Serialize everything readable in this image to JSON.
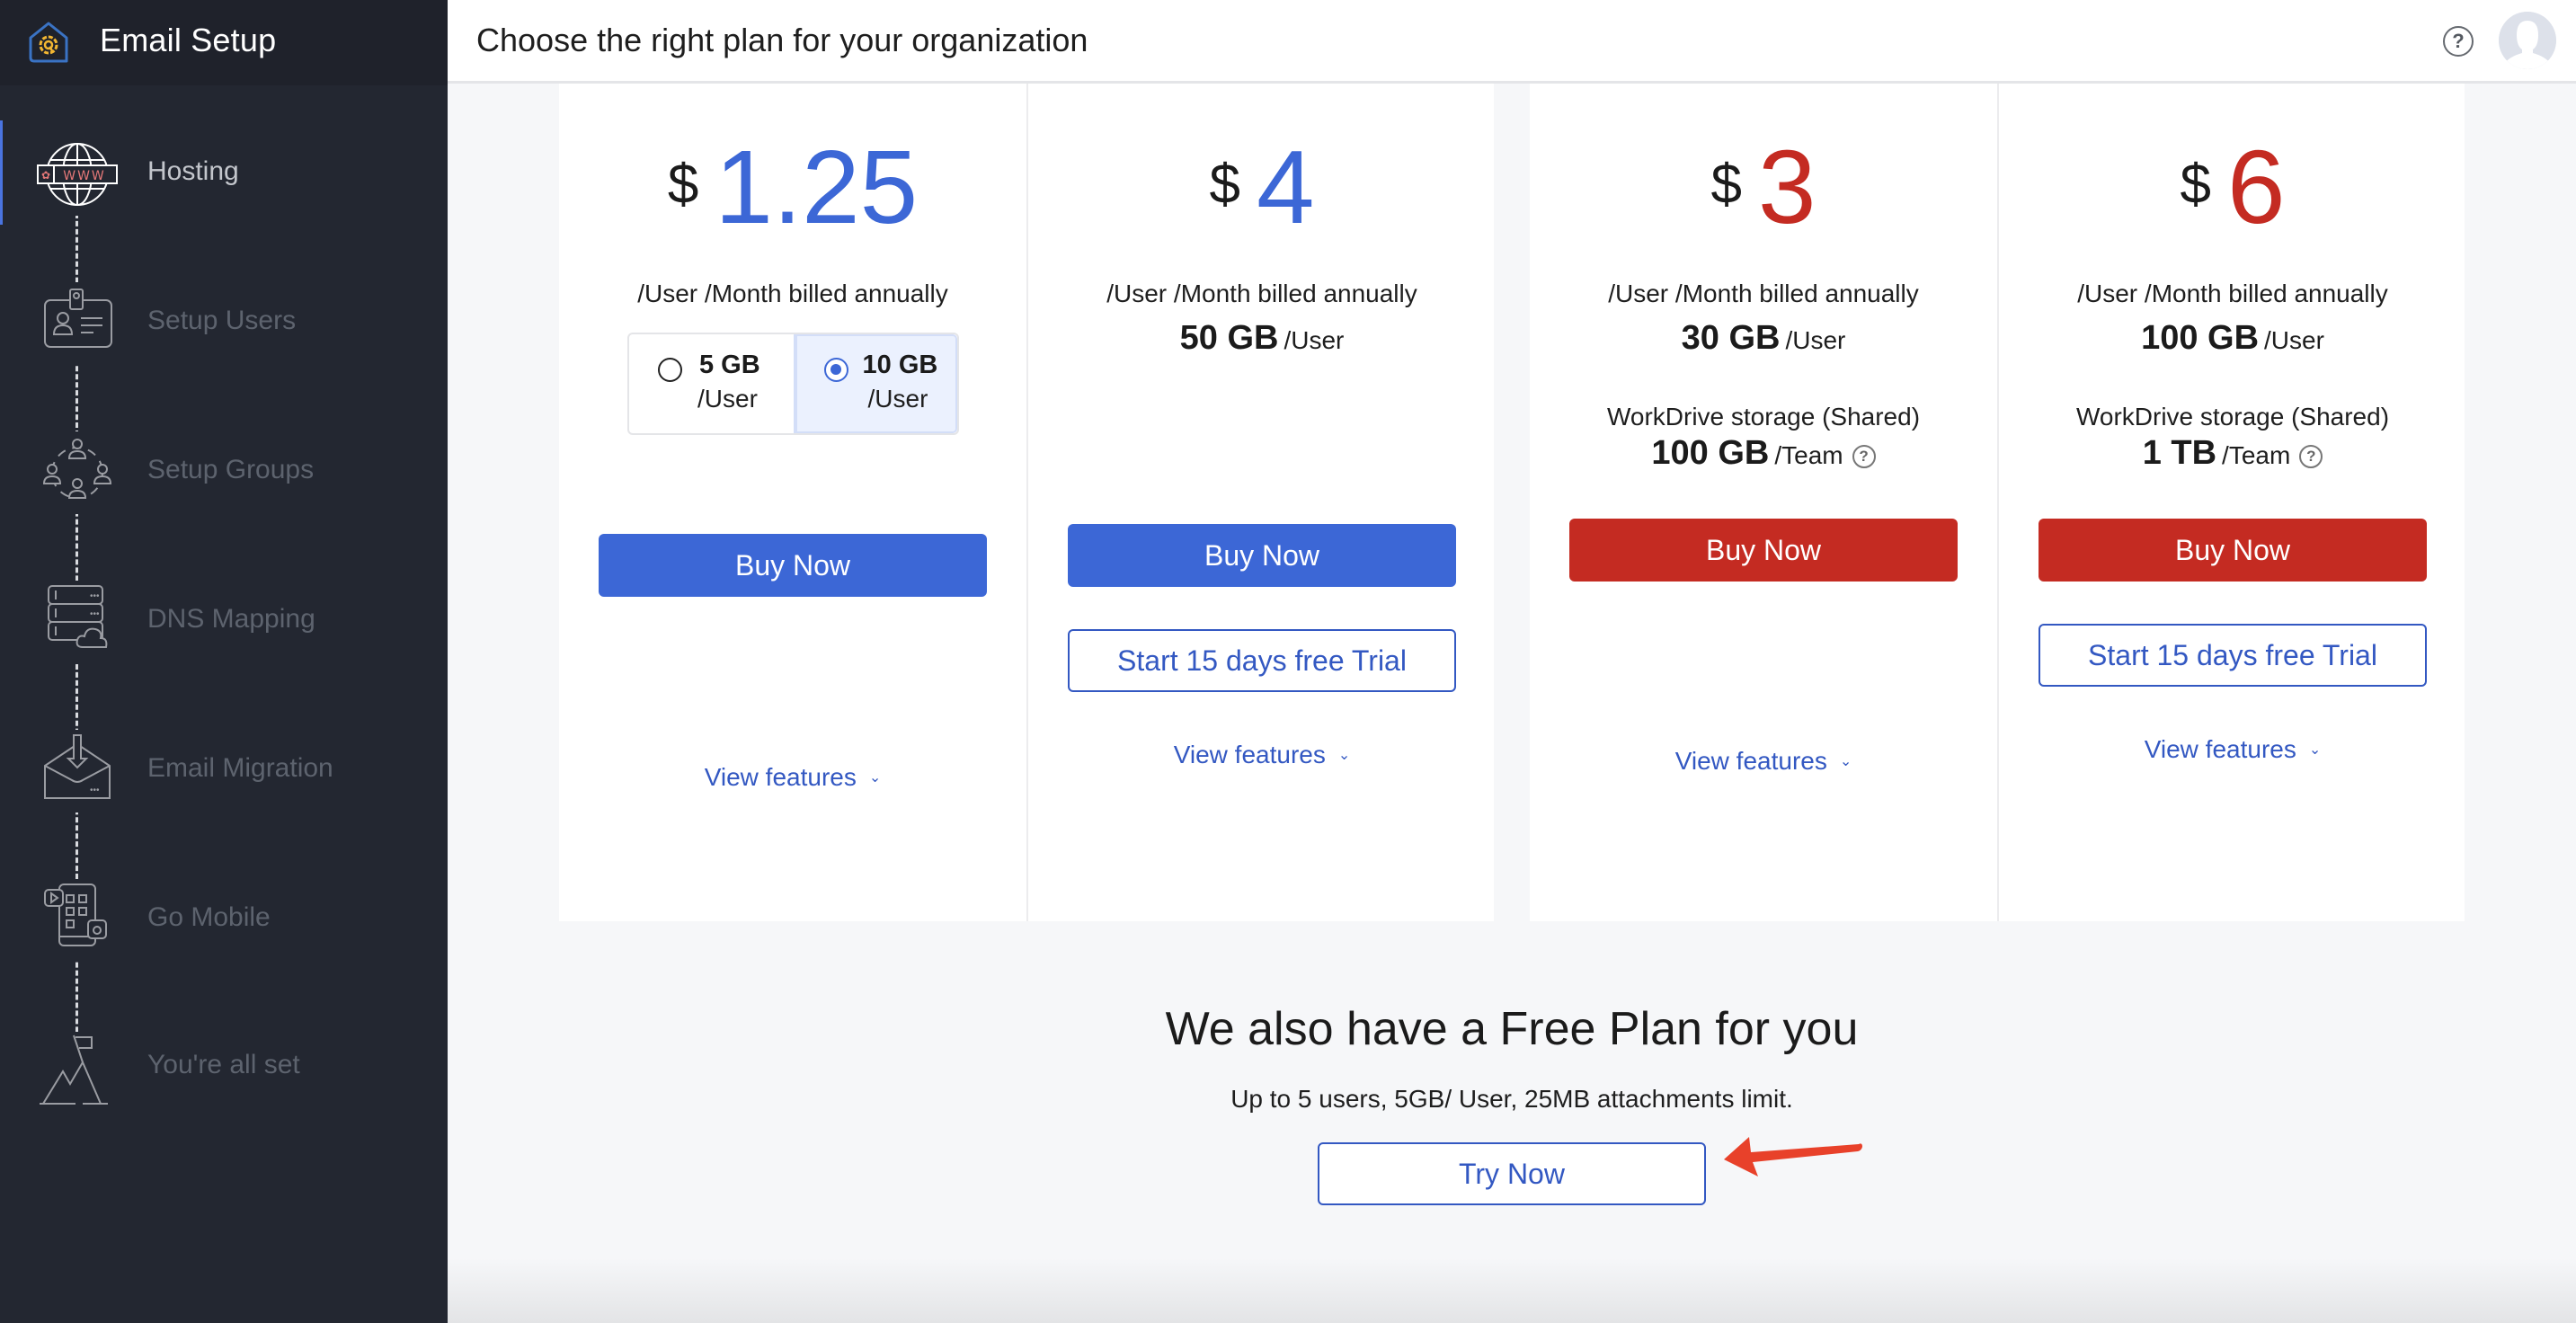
{
  "sidebar": {
    "title": "Email Setup",
    "logo_icon": "house-gear-icon",
    "steps": [
      {
        "label": "Hosting",
        "icon": "globe-www-icon",
        "active": true
      },
      {
        "label": "Setup Users",
        "icon": "id-badge-icon",
        "active": false
      },
      {
        "label": "Setup Groups",
        "icon": "group-circle-icon",
        "active": false
      },
      {
        "label": "DNS Mapping",
        "icon": "server-cloud-icon",
        "active": false
      },
      {
        "label": "Email Migration",
        "icon": "envelope-download-icon",
        "active": false
      },
      {
        "label": "Go Mobile",
        "icon": "mobile-apps-icon",
        "active": false
      },
      {
        "label": "You're all set",
        "icon": "mountain-flag-icon",
        "active": false
      }
    ]
  },
  "header": {
    "title": "Choose the right plan for your organization",
    "help_icon": "?",
    "avatar_icon": "user-avatar-icon"
  },
  "plans": [
    {
      "currency": "$",
      "price": "1.25",
      "price_color": "#3c67d6",
      "billing": "/User /Month billed annually",
      "storage_options": [
        {
          "size": "5 GB",
          "unit": "/User",
          "selected": false
        },
        {
          "size": "10 GB",
          "unit": "/User",
          "selected": true
        }
      ],
      "buy_label": "Buy Now",
      "view_features": "View features"
    },
    {
      "currency": "$",
      "price": "4",
      "price_color": "#3c67d6",
      "billing": "/User /Month billed annually",
      "storage": "50 GB",
      "storage_unit": "/User",
      "buy_label": "Buy Now",
      "trial_label": "Start 15 days free Trial",
      "view_features": "View features"
    },
    {
      "currency": "$",
      "price": "3",
      "price_color": "#c42b22",
      "billing": "/User /Month billed annually",
      "storage": "30 GB",
      "storage_unit": "/User",
      "workdrive_label": "WorkDrive storage (Shared)",
      "workdrive_size": "100 GB",
      "workdrive_unit": "/Team",
      "buy_label": "Buy Now",
      "view_features": "View features"
    },
    {
      "currency": "$",
      "price": "6",
      "price_color": "#c42b22",
      "billing": "/User /Month billed annually",
      "storage": "100 GB",
      "storage_unit": "/User",
      "workdrive_label": "WorkDrive storage (Shared)",
      "workdrive_size": "1 TB",
      "workdrive_unit": "/Team",
      "buy_label": "Buy Now",
      "trial_label": "Start 15 days free Trial",
      "view_features": "View features"
    }
  ],
  "free_plan": {
    "title": "We also have a Free Plan for you",
    "subtitle": "Up to 5 users, 5GB/ User, 25MB attachments limit.",
    "button_label": "Try Now"
  },
  "colors": {
    "sidebar_bg": "#232731",
    "accent_blue": "#3c67d6",
    "accent_red": "#c42b22",
    "link_blue": "#3358c2",
    "annotation_arrow": "#e8412a"
  },
  "icons": {
    "chevron": "⌄",
    "question": "?"
  }
}
